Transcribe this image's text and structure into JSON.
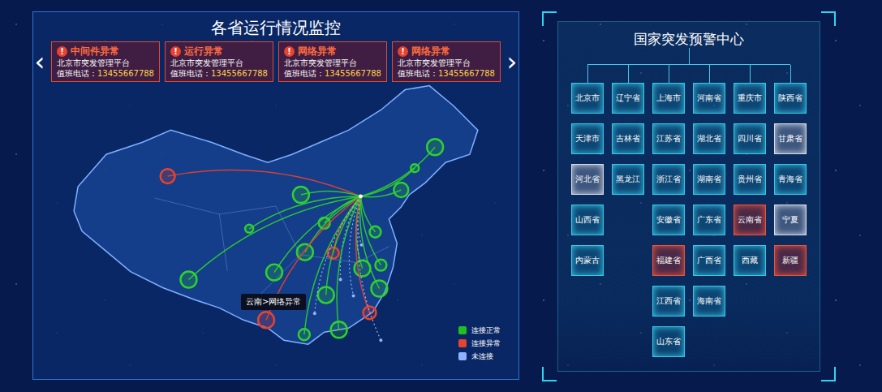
{
  "left_panel": {
    "title": "各省运行情况监控",
    "prev_arrow": "‹",
    "next_arrow": "›",
    "alerts": [
      {
        "icon": "!",
        "title": "中间件异常",
        "platform": "北京市突发管理平台",
        "phone_label": "值班电话：",
        "phone": "13455667788"
      },
      {
        "icon": "!",
        "title": "运行异常",
        "platform": "北京市突发管理平台",
        "phone_label": "值班电话：",
        "phone": "13455667788"
      },
      {
        "icon": "!",
        "title": "网络异常",
        "platform": "北京市突发管理平台",
        "phone_label": "值班电话：",
        "phone": "13455667788"
      },
      {
        "icon": "!",
        "title": "网络异常",
        "platform": "北京市突发管理平台",
        "phone_label": "值班电话：",
        "phone": "13455667788"
      }
    ],
    "map": {
      "tooltip": "云南>网络异常",
      "connections": [
        {
          "status": "normal",
          "color": "#2ed12e"
        },
        {
          "status": "normal",
          "color": "#2ed12e"
        },
        {
          "status": "normal",
          "color": "#2ed12e"
        },
        {
          "status": "abnormal",
          "color": "#e8432e"
        },
        {
          "status": "normal",
          "color": "#2ed12e"
        },
        {
          "status": "normal",
          "color": "#2ed12e"
        },
        {
          "status": "normal",
          "color": "#2ed12e"
        },
        {
          "status": "normal",
          "color": "#2ed12e"
        },
        {
          "status": "normal",
          "color": "#2ed12e"
        },
        {
          "status": "abnormal",
          "color": "#e8432e"
        },
        {
          "status": "unconnected",
          "color": "#9fc0ff"
        },
        {
          "status": "normal",
          "color": "#2ed12e"
        },
        {
          "status": "normal",
          "color": "#2ed12e"
        },
        {
          "status": "normal",
          "color": "#2ed12e"
        },
        {
          "status": "normal",
          "color": "#2ed12e"
        },
        {
          "status": "unconnected",
          "color": "#9fc0ff"
        },
        {
          "status": "normal",
          "color": "#2ed12e"
        },
        {
          "status": "normal",
          "color": "#2ed12e"
        },
        {
          "status": "unconnected",
          "color": "#9fc0ff"
        },
        {
          "status": "abnormal",
          "color": "#e8432e"
        },
        {
          "status": "abnormal",
          "color": "#e8432e"
        },
        {
          "status": "normal",
          "color": "#2ed12e"
        },
        {
          "status": "normal",
          "color": "#2ed12e"
        },
        {
          "status": "unconnected",
          "color": "#9fc0ff"
        },
        {
          "status": "unconnected",
          "color": "#9fc0ff"
        }
      ],
      "legend": [
        {
          "label": "连接正常",
          "color": "#1fc11f"
        },
        {
          "label": "连接异常",
          "color": "#e8432e"
        },
        {
          "label": "未连接",
          "color": "#8fb3ff"
        }
      ]
    }
  },
  "right_panel": {
    "title": "国家突发预警中心",
    "columns": [
      [
        {
          "name": "北京市",
          "status": "normal",
          "color": "#35c8e6"
        },
        {
          "name": "天津市",
          "status": "normal",
          "color": "#35c8e6"
        },
        {
          "name": "河北省",
          "status": "unconnected",
          "color": "#d8dde8"
        },
        {
          "name": "山西省",
          "status": "normal",
          "color": "#35c8e6"
        },
        {
          "name": "内蒙古",
          "status": "normal",
          "color": "#35c8e6"
        }
      ],
      [
        {
          "name": "辽宁省",
          "status": "normal",
          "color": "#35c8e6"
        },
        {
          "name": "吉林省",
          "status": "normal",
          "color": "#35c8e6"
        },
        {
          "name": "黑龙江",
          "status": "normal",
          "color": "#35c8e6"
        }
      ],
      [
        {
          "name": "上海市",
          "status": "normal",
          "color": "#35c8e6"
        },
        {
          "name": "江苏省",
          "status": "normal",
          "color": "#35c8e6"
        },
        {
          "name": "浙江省",
          "status": "normal",
          "color": "#35c8e6"
        },
        {
          "name": "安徽省",
          "status": "normal",
          "color": "#35c8e6"
        },
        {
          "name": "福建省",
          "status": "abnormal",
          "color": "#e8533e"
        },
        {
          "name": "江西省",
          "status": "normal",
          "color": "#35c8e6"
        },
        {
          "name": "山东省",
          "status": "normal",
          "color": "#35c8e6"
        }
      ],
      [
        {
          "name": "河南省",
          "status": "normal",
          "color": "#35c8e6"
        },
        {
          "name": "湖北省",
          "status": "normal",
          "color": "#35c8e6"
        },
        {
          "name": "湖南省",
          "status": "normal",
          "color": "#35c8e6"
        },
        {
          "name": "广东省",
          "status": "normal",
          "color": "#35c8e6"
        },
        {
          "name": "广西省",
          "status": "normal",
          "color": "#35c8e6"
        },
        {
          "name": "海南省",
          "status": "normal",
          "color": "#35c8e6"
        }
      ],
      [
        {
          "name": "重庆市",
          "status": "normal",
          "color": "#35c8e6"
        },
        {
          "name": "四川省",
          "status": "normal",
          "color": "#35c8e6"
        },
        {
          "name": "贵州省",
          "status": "normal",
          "color": "#35c8e6"
        },
        {
          "name": "云南省",
          "status": "abnormal",
          "color": "#e8533e"
        },
        {
          "name": "西藏",
          "status": "normal",
          "color": "#35c8e6"
        }
      ],
      [
        {
          "name": "陕西省",
          "status": "normal",
          "color": "#35c8e6"
        },
        {
          "name": "甘肃省",
          "status": "unconnected",
          "color": "#d8dde8"
        },
        {
          "name": "青海省",
          "status": "normal",
          "color": "#35c8e6"
        },
        {
          "name": "宁夏",
          "status": "unconnected",
          "color": "#d8dde8"
        },
        {
          "name": "新疆",
          "status": "abnormal",
          "color": "#e8533e"
        }
      ]
    ]
  }
}
